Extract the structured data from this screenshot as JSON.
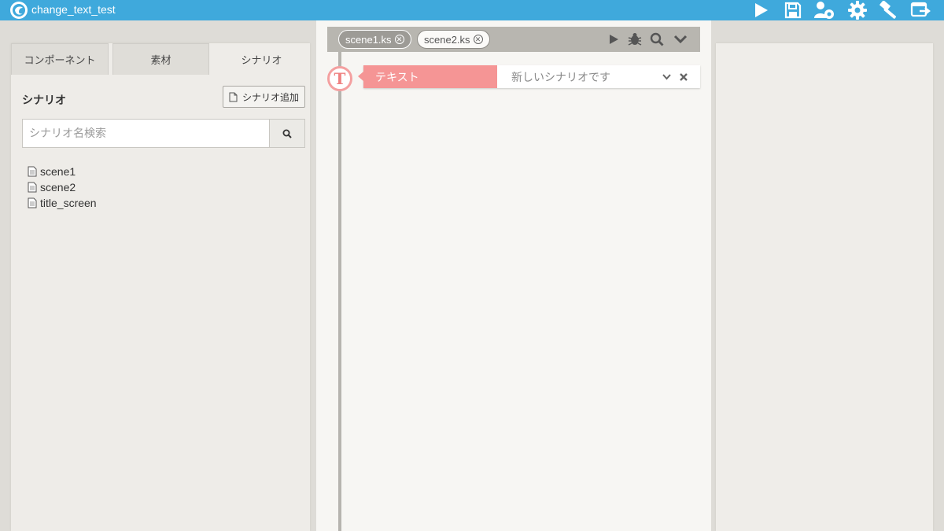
{
  "window": {
    "title": "change_text_test"
  },
  "titlebar_icons": [
    {
      "name": "play-icon",
      "label": "Play"
    },
    {
      "name": "save-icon",
      "label": "Save"
    },
    {
      "name": "project-settings-icon",
      "label": "Project settings"
    },
    {
      "name": "gear-icon",
      "label": "Settings"
    },
    {
      "name": "build-hammer-icon",
      "label": "Build"
    },
    {
      "name": "export-icon",
      "label": "Export"
    }
  ],
  "left_panel": {
    "tabs": [
      {
        "label": "コンポーネント",
        "active": false
      },
      {
        "label": "素材",
        "active": false
      },
      {
        "label": "シナリオ",
        "active": true
      }
    ],
    "section_title": "シナリオ",
    "add_button_label": "シナリオ追加",
    "search": {
      "placeholder": "シナリオ名検索",
      "value": ""
    },
    "files": [
      {
        "name": "scene1"
      },
      {
        "name": "scene2"
      },
      {
        "name": "title_screen"
      }
    ]
  },
  "editor": {
    "open_tabs": [
      {
        "label": "scene1.ks",
        "active": true
      },
      {
        "label": "scene2.ks",
        "active": false
      }
    ],
    "toolbar_icons": [
      "play-icon",
      "debug-bug-icon",
      "search-icon",
      "chevron-down-icon"
    ],
    "tags": [
      {
        "node_letter": "T",
        "label": "テキスト",
        "value": "新しいシナリオです"
      }
    ]
  },
  "colors": {
    "titlebar": "#3fa9dc",
    "tag_accent": "#f59595",
    "toolbar": "#b8b6b0"
  }
}
